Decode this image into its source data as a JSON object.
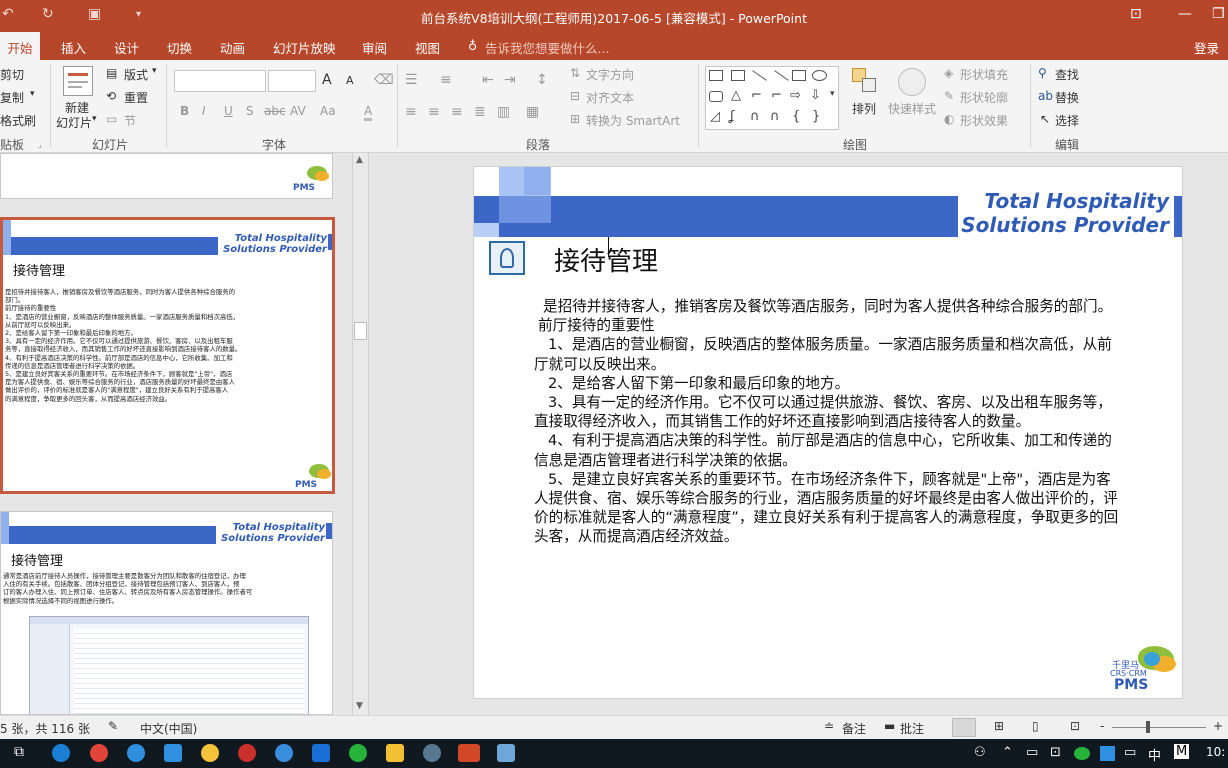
{
  "window": {
    "title": "前台系统V8培训大纲(工程师用)2017-06-5 [兼容模式] - PowerPoint",
    "minimize_icon": "minimize-icon",
    "close_icon": "close-icon"
  },
  "tabs": [
    "开始",
    "插入",
    "设计",
    "切换",
    "动画",
    "幻灯片放映",
    "审阅",
    "视图"
  ],
  "tell_me": "告诉我您想要做什么...",
  "login": "登录",
  "ribbon": {
    "clipboard": {
      "cut": "剪切",
      "copy": "复制",
      "format_painter": "格式刷",
      "label": "贴板"
    },
    "slides": {
      "new_slide": "新建",
      "new_slide2": "幻灯片",
      "layout": "版式",
      "reset": "重置",
      "section": "节",
      "label": "幻灯片"
    },
    "font": {
      "label": "字体",
      "bold": "B",
      "italic": "I",
      "underline": "U",
      "strike": "S",
      "spacing": "abc",
      "case": "Aa",
      "grow": "A",
      "shrink": "A"
    },
    "paragraph": {
      "label": "段落",
      "text_dir": "文字方向",
      "align_text": "对齐文本",
      "smartart": "转换为 SmartArt"
    },
    "drawing": {
      "label": "绘图",
      "arrange": "排列",
      "quick_styles": "快速样式",
      "fill": "形状填充",
      "outline": "形状轮廓",
      "effects": "形状效果"
    },
    "editing": {
      "label": "编辑",
      "find": "查找",
      "replace": "替换",
      "select": "选择"
    }
  },
  "brand": {
    "line1": "Total Hospitality",
    "line2": "Solutions Provider",
    "logo_cn": "千里马",
    "logo_sub": "CRS·CRM",
    "logo_pms": "PMS"
  },
  "thumb2": {
    "title": "接待管理",
    "lines": [
      "是招待并接待客人，推销客房及餐饮等酒店服务，同时为客人提供各种综合服务的",
      "部门。",
      "前厅接待的重要性",
      "1、是酒店的营业橱窗，反映酒店的整体服务质量。一家酒店服务质量和档次高低，",
      "从前厅就可以反映出来。",
      "2、是给客人留下第一印象和最后印象的地方。",
      "3、具有一定的经济作用。它不仅可以通过提供旅游、餐饮、客房、以及出租车服",
      "务等，直接取得经济收入，而其销售工作的好坏还直接影响到酒店接待客人的数量。",
      "4、有利于提高酒店决策的科学性。前厅部是酒店的信息中心，它所收集、加工和",
      "传递的信息是酒店管理者进行科学决策的依据。",
      "5、是建立良好宾客关系的重要环节。在市场经济条件下，顾客就是\"上帝\"，酒店",
      "是为客人提供食、宿、娱乐等综合服务的行业，酒店服务质量的好坏最终是由客人",
      "做出评价的，评价的标准就是客人的\"满意程度\"，建立良好关系有利于提高客人",
      "的满意程度，争取更多的回头客，从而提高酒店经济效益。"
    ]
  },
  "thumb3": {
    "title": "接待管理",
    "lines": [
      "通常是酒店前厅接待人员操作，接待管理主要是散客分为团队和散客的住宿登记，办理",
      "入住的有关手续。包括散客、团体分组登记，接待管理包括预订客人、到店客人，预",
      "订的客人办理入住、同上预订单、住店客人、转点房及所有客人房态管理操作。操作者可",
      "根据实际情况选择不同的视图进行操作。"
    ]
  },
  "slide": {
    "title": "接待管理",
    "paragraphs": [
      "是招待并接待客人，推销客房及餐饮等酒店服务，同时为客人提供各种综合服务的部门。",
      "前厅接待的重要性",
      "1、是酒店的营业橱窗，反映酒店的整体服务质量。一家酒店服务质量和档次高低，从前厅就可以反映出来。",
      "2、是给客人留下第一印象和最后印象的地方。",
      "3、具有一定的经济作用。它不仅可以通过提供旅游、餐饮、客房、以及出租车服务等，直接取得经济收入，而其销售工作的好坏还直接影响到酒店接待客人的数量。",
      "4、有利于提高酒店决策的科学性。前厅部是酒店的信息中心，它所收集、加工和传递的信息是酒店管理者进行科学决策的依据。",
      "5、是建立良好宾客关系的重要环节。在市场经济条件下，顾客就是\"上帝\"，酒店是为客人提供食、宿、娱乐等综合服务的行业，酒店服务质量的好坏最终是由客人做出评价的，评价的标准就是客人的“满意程度”，建立良好关系有利于提高客人的满意程度，争取更多的回头客，从而提高酒店经济效益。"
    ]
  },
  "status": {
    "slide_count": "5 张，共 116 张",
    "language": "中文(中国)",
    "notes": "备注",
    "comments": "批注",
    "zoom_minus": "-",
    "zoom_plus": "+"
  },
  "taskbar": {
    "clock": "10:",
    "ime": "中",
    "keyboard": "M"
  }
}
